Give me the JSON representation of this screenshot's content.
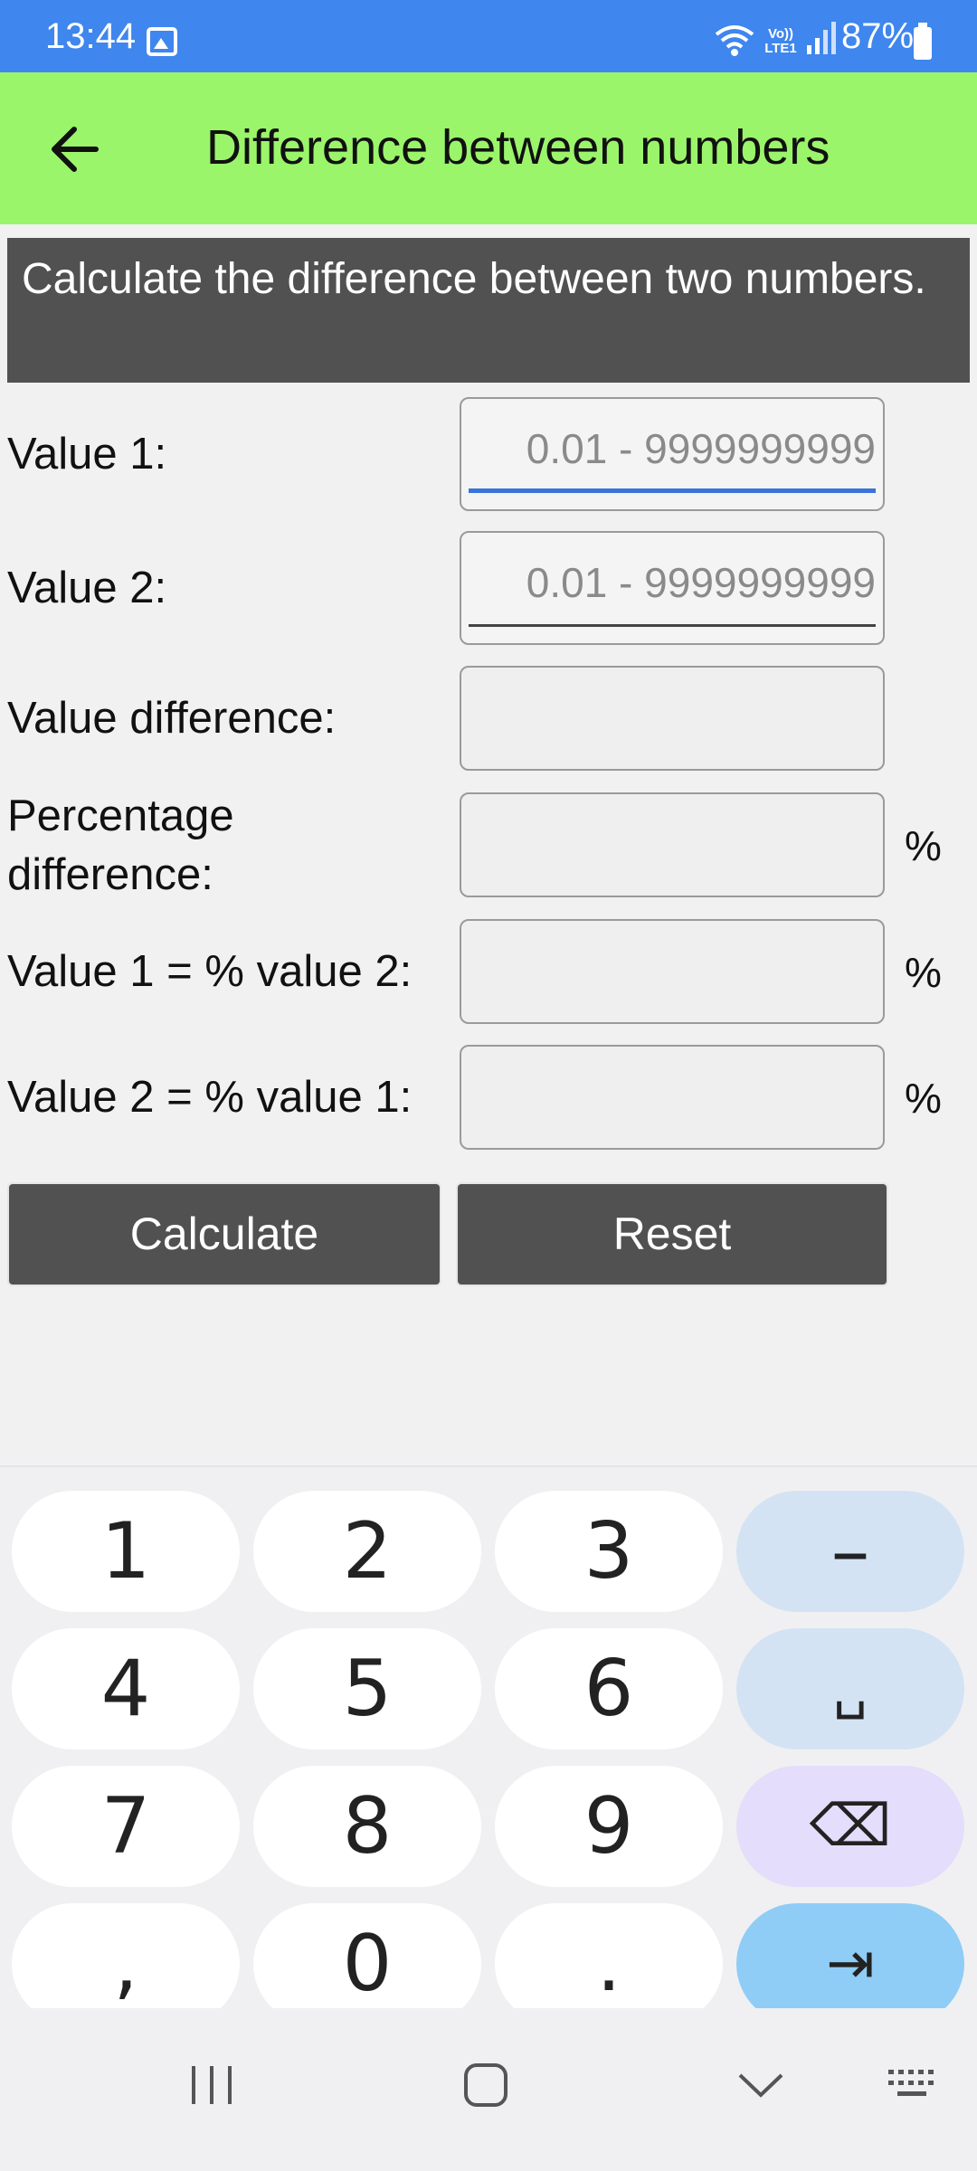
{
  "status_bar": {
    "time": "13:44",
    "network": "Vo)) LTE1",
    "battery": "87%",
    "icons": [
      "gallery-icon",
      "wifi-icon",
      "signal-icon",
      "battery-icon"
    ]
  },
  "app_bar": {
    "back_icon": "arrow-left-icon",
    "title": "Difference between numbers",
    "color": "#9bf56a"
  },
  "banner": {
    "text": "Calculate the difference between two numbers."
  },
  "form": {
    "value1": {
      "label": "Value 1:",
      "placeholder": "0.01 - 9999999999",
      "value": ""
    },
    "value2": {
      "label": "Value 2:",
      "placeholder": "0.01 - 9999999999",
      "value": ""
    },
    "value_difference": {
      "label": "Value difference:",
      "value": ""
    },
    "percentage_difference": {
      "label_line1": "Percentage",
      "label_line2": "difference:",
      "value": "",
      "unit": "%"
    },
    "v1_pct_v2": {
      "label": "Value 1 = % value 2:",
      "value": "",
      "unit": "%"
    },
    "v2_pct_v1": {
      "label": "Value 2 = % value 1:",
      "value": "",
      "unit": "%"
    }
  },
  "buttons": {
    "calculate": "Calculate",
    "reset": "Reset"
  },
  "keyboard": {
    "rows": [
      [
        "1",
        "2",
        "3",
        "–"
      ],
      [
        "4",
        "5",
        "6",
        "␣"
      ],
      [
        "7",
        "8",
        "9",
        "⌫"
      ],
      [
        ",",
        "0",
        ".",
        "⇥"
      ]
    ]
  },
  "nav_bar": {
    "icons": [
      "recent-apps-icon",
      "home-icon",
      "hide-keyboard-icon",
      "keyboard-switch-icon"
    ]
  }
}
